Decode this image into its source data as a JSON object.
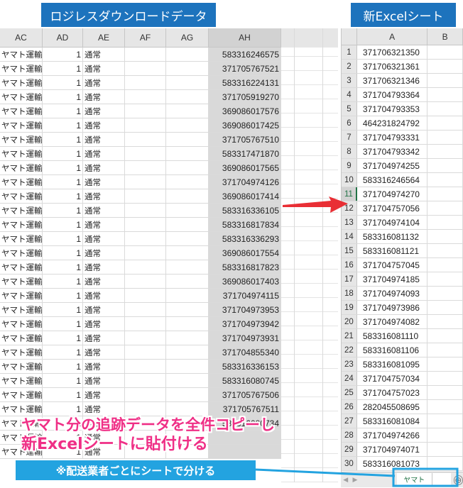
{
  "labels": {
    "left": "ロジレスダウンロードデータ",
    "right": "新Excelシート"
  },
  "left_sheet": {
    "columns": [
      "AC",
      "AD",
      "AE",
      "AF",
      "AG",
      "AH"
    ],
    "rows": [
      [
        "ヤマト運輸",
        "1",
        "通常",
        "583316246575"
      ],
      [
        "ヤマト運輸",
        "1",
        "通常",
        "371705767521"
      ],
      [
        "ヤマト運輸",
        "1",
        "通常",
        "583316224131"
      ],
      [
        "ヤマト運輸",
        "1",
        "通常",
        "371705919270"
      ],
      [
        "ヤマト運輸",
        "1",
        "通常",
        "369086017576"
      ],
      [
        "ヤマト運輸",
        "1",
        "通常",
        "369086017425"
      ],
      [
        "ヤマト運輸",
        "1",
        "通常",
        "371705767510"
      ],
      [
        "ヤマト運輸",
        "1",
        "通常",
        "583317471870"
      ],
      [
        "ヤマト運輸",
        "1",
        "通常",
        "369086017565"
      ],
      [
        "ヤマト運輸",
        "1",
        "通常",
        "371704974126"
      ],
      [
        "ヤマト運輸",
        "1",
        "通常",
        "369086017414"
      ],
      [
        "ヤマト運輸",
        "1",
        "通常",
        "583316336105"
      ],
      [
        "ヤマト運輸",
        "1",
        "通常",
        "583316817834"
      ],
      [
        "ヤマト運輸",
        "1",
        "通常",
        "583316336293"
      ],
      [
        "ヤマト運輸",
        "1",
        "通常",
        "369086017554"
      ],
      [
        "ヤマト運輸",
        "1",
        "通常",
        "583316817823"
      ],
      [
        "ヤマト運輸",
        "1",
        "通常",
        "369086017403"
      ],
      [
        "ヤマト運輸",
        "1",
        "通常",
        "371704974115"
      ],
      [
        "ヤマト運輸",
        "1",
        "通常",
        "371704973953"
      ],
      [
        "ヤマト運輸",
        "1",
        "通常",
        "371704973942"
      ],
      [
        "ヤマト運輸",
        "1",
        "通常",
        "371704973931"
      ],
      [
        "ヤマト運輸",
        "1",
        "通常",
        "371704855340"
      ],
      [
        "ヤマト運輸",
        "1",
        "通常",
        "583316336153"
      ],
      [
        "ヤマト運輸",
        "1",
        "通常",
        "583316080745"
      ],
      [
        "ヤマト運輸",
        "1",
        "通常",
        "371705767506"
      ],
      [
        "ヤマト運輸",
        "1",
        "通常",
        "371705767511"
      ],
      [
        "ヤマト運輸",
        "1",
        "通常",
        "583316080734"
      ],
      [
        "ヤマト運輸",
        "1",
        "通常",
        ""
      ],
      [
        "ヤマト運輸",
        "1",
        "通常",
        ""
      ]
    ]
  },
  "right_sheet": {
    "columns": [
      "A",
      "B"
    ],
    "active_row": "11",
    "rows": [
      [
        "1",
        "371706321350"
      ],
      [
        "2",
        "371706321361"
      ],
      [
        "3",
        "371706321346"
      ],
      [
        "4",
        "371704793364"
      ],
      [
        "5",
        "371704793353"
      ],
      [
        "6",
        "464231824792"
      ],
      [
        "7",
        "371704793331"
      ],
      [
        "8",
        "371704793342"
      ],
      [
        "9",
        "371704974255"
      ],
      [
        "10",
        "583316246564"
      ],
      [
        "11",
        "371704974270"
      ],
      [
        "12",
        "371704757056"
      ],
      [
        "13",
        "371704974104"
      ],
      [
        "14",
        "583316081132"
      ],
      [
        "15",
        "583316081121"
      ],
      [
        "16",
        "371704757045"
      ],
      [
        "17",
        "371704974185"
      ],
      [
        "18",
        "371704974093"
      ],
      [
        "19",
        "371704973986"
      ],
      [
        "20",
        "371704974082"
      ],
      [
        "21",
        "583316081110"
      ],
      [
        "22",
        "583316081106"
      ],
      [
        "23",
        "583316081095"
      ],
      [
        "24",
        "371704757034"
      ],
      [
        "25",
        "371704757023"
      ],
      [
        "26",
        "282045508695"
      ],
      [
        "27",
        "583316081084"
      ],
      [
        "28",
        "371704974266"
      ],
      [
        "29",
        "371704974071"
      ],
      [
        "30",
        "583316081073"
      ]
    ],
    "sheet_tab": "ヤマト",
    "add_sheet": "⊕"
  },
  "annotations": {
    "caption_line1": "ヤマト分の追跡データを全件コピーし",
    "caption_line2": "新Excelシートに貼付ける",
    "note": "※配送業者ごとにシートで分ける"
  },
  "colors": {
    "label_bg": "#1d73bd",
    "caption": "#ef2f86",
    "note_bg": "#23a3e0",
    "arrow": "#e8242a",
    "excel_green": "#217346"
  }
}
